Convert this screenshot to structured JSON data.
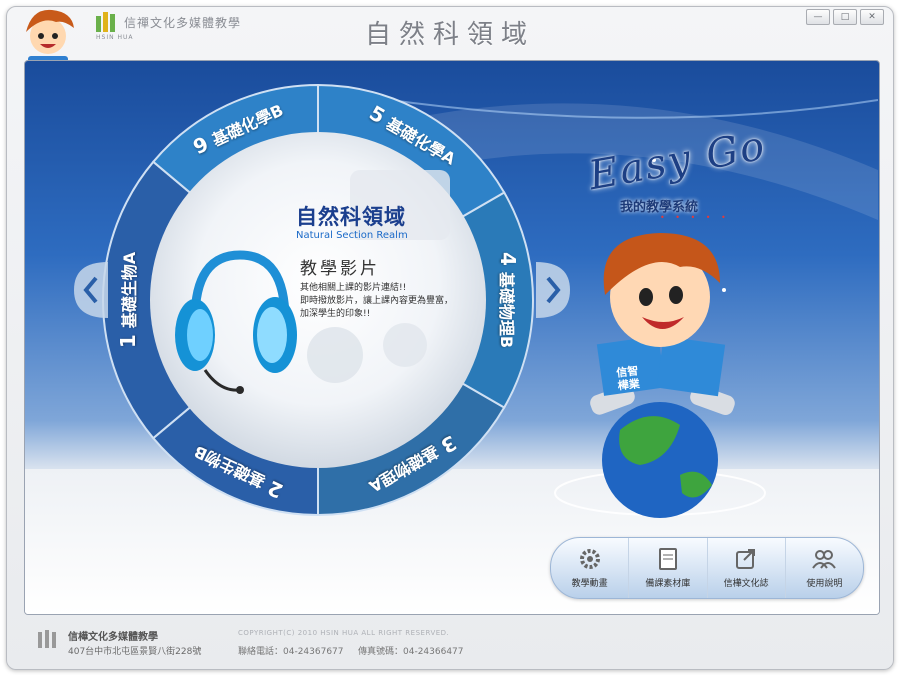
{
  "window": {
    "brand": "信禪文化多媒體教學",
    "brand_sub": "HSIN HUA",
    "title": "自然科領域",
    "controls": [
      "—",
      "□",
      "✕"
    ]
  },
  "wheel": {
    "segments": [
      {
        "num": "1",
        "label": "基礎生物A"
      },
      {
        "num": "2",
        "label": "基礎生物B"
      },
      {
        "num": "3",
        "label": "基礎物理A"
      },
      {
        "num": "4",
        "label": "基礎物理B"
      },
      {
        "num": "5",
        "label": "基礎化學A"
      },
      {
        "num": "9",
        "label": "基礎化學B"
      }
    ]
  },
  "center": {
    "title": "自然科領域",
    "subtitle": "Natural Section Realm",
    "heading": "教學影片",
    "desc": [
      "其他相關上課的影片連結!!",
      "即時撥放影片，讓上課內容更為豐富，",
      "加深學生的印象!!"
    ]
  },
  "promo": {
    "easy": "Easy Go",
    "subtitle": "我的教學系統",
    "book_text": "信智樺業"
  },
  "toolbar": [
    {
      "label": "教學動畫",
      "icon": "gear-icon"
    },
    {
      "label": "備課素材庫",
      "icon": "notebook-icon"
    },
    {
      "label": "信樺文化誌",
      "icon": "share-icon"
    },
    {
      "label": "使用說明",
      "icon": "users-icon"
    }
  ],
  "footer": {
    "company": "信樺文化多媒體教學",
    "address": "407台中市北屯區景賢八街228號",
    "copyright": "COPYRIGHT(C) 2010 HSIN HUA ALL RIGHT RESERVED.",
    "tel": "聯絡電話：04-24367677",
    "fax": "傳真號碼：04-24366477"
  },
  "colors": {
    "accent": "#1b3f8e",
    "wheel_light": "#2e82c8",
    "wheel_dark": "#2a5fa8"
  }
}
